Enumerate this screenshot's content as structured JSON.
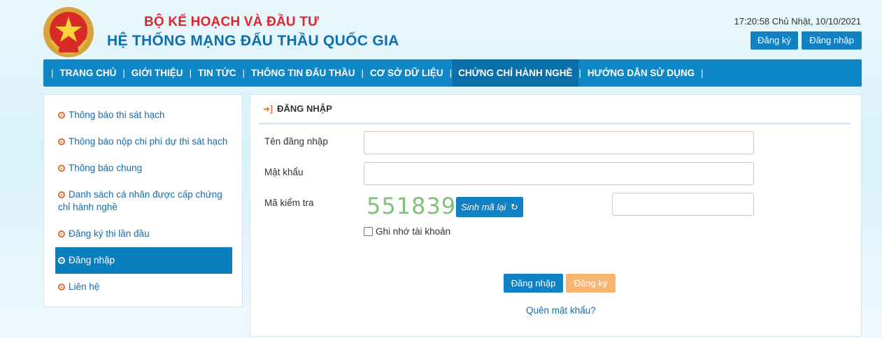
{
  "header": {
    "ministry": "BỘ KẾ HOẠCH VÀ ĐẦU TƯ",
    "system_name": "HỆ THỐNG MẠNG ĐẤU THẦU QUỐC GIA",
    "datetime": "17:20:58 Chủ Nhật, 10/10/2021",
    "register_label": "Đăng ký",
    "login_label": "Đăng nhập"
  },
  "nav": {
    "items": [
      {
        "label": "TRANG CHỦ"
      },
      {
        "label": "GIỚI THIỆU"
      },
      {
        "label": "TIN TỨC"
      },
      {
        "label": "THÔNG TIN ĐẤU THẦU"
      },
      {
        "label": "CƠ SỞ DỮ LIỆU"
      },
      {
        "label": "CHỨNG CHỈ HÀNH NGHỀ",
        "active": true
      },
      {
        "label": "HƯỚNG DẪN SỬ DỤNG"
      }
    ]
  },
  "sidebar": {
    "items": [
      {
        "label": "Thông báo thi sát hạch"
      },
      {
        "label": "Thông báo nộp chi phí dự thi sát hạch"
      },
      {
        "label": "Thông báo chung"
      },
      {
        "label": "Danh sách cá nhân được cấp chứng chỉ hành nghề"
      },
      {
        "label": "Đăng ký thi lần đầu"
      },
      {
        "label": "Đăng nhập",
        "active": true
      },
      {
        "label": "Liên hệ"
      }
    ]
  },
  "login": {
    "title": "ĐĂNG NHẬP",
    "username_label": "Tên đăng nhập",
    "username_value": "",
    "password_label": "Mật khẩu",
    "password_value": "",
    "captcha_label": "Mã kiểm tra",
    "captcha_code": "551839",
    "regenerate_label": "Sinh mã lại",
    "captcha_value": "",
    "remember_label": "Ghi nhớ tài khoản",
    "login_button": "Đăng nhập",
    "register_button": "Đăng ký",
    "forgot_link": "Quên mật khẩu?"
  },
  "colors": {
    "primary": "#1181c3",
    "nav_bg": "#0f87c6",
    "accent_red": "#e0262c",
    "captcha_green": "#7fc07b",
    "register_orange": "#f8b572"
  },
  "icons": {
    "emblem": "national-emblem",
    "panel_title": "sign-in-icon",
    "regenerate": "refresh-icon",
    "sidebar_bullet": "circle-dot-icon"
  }
}
